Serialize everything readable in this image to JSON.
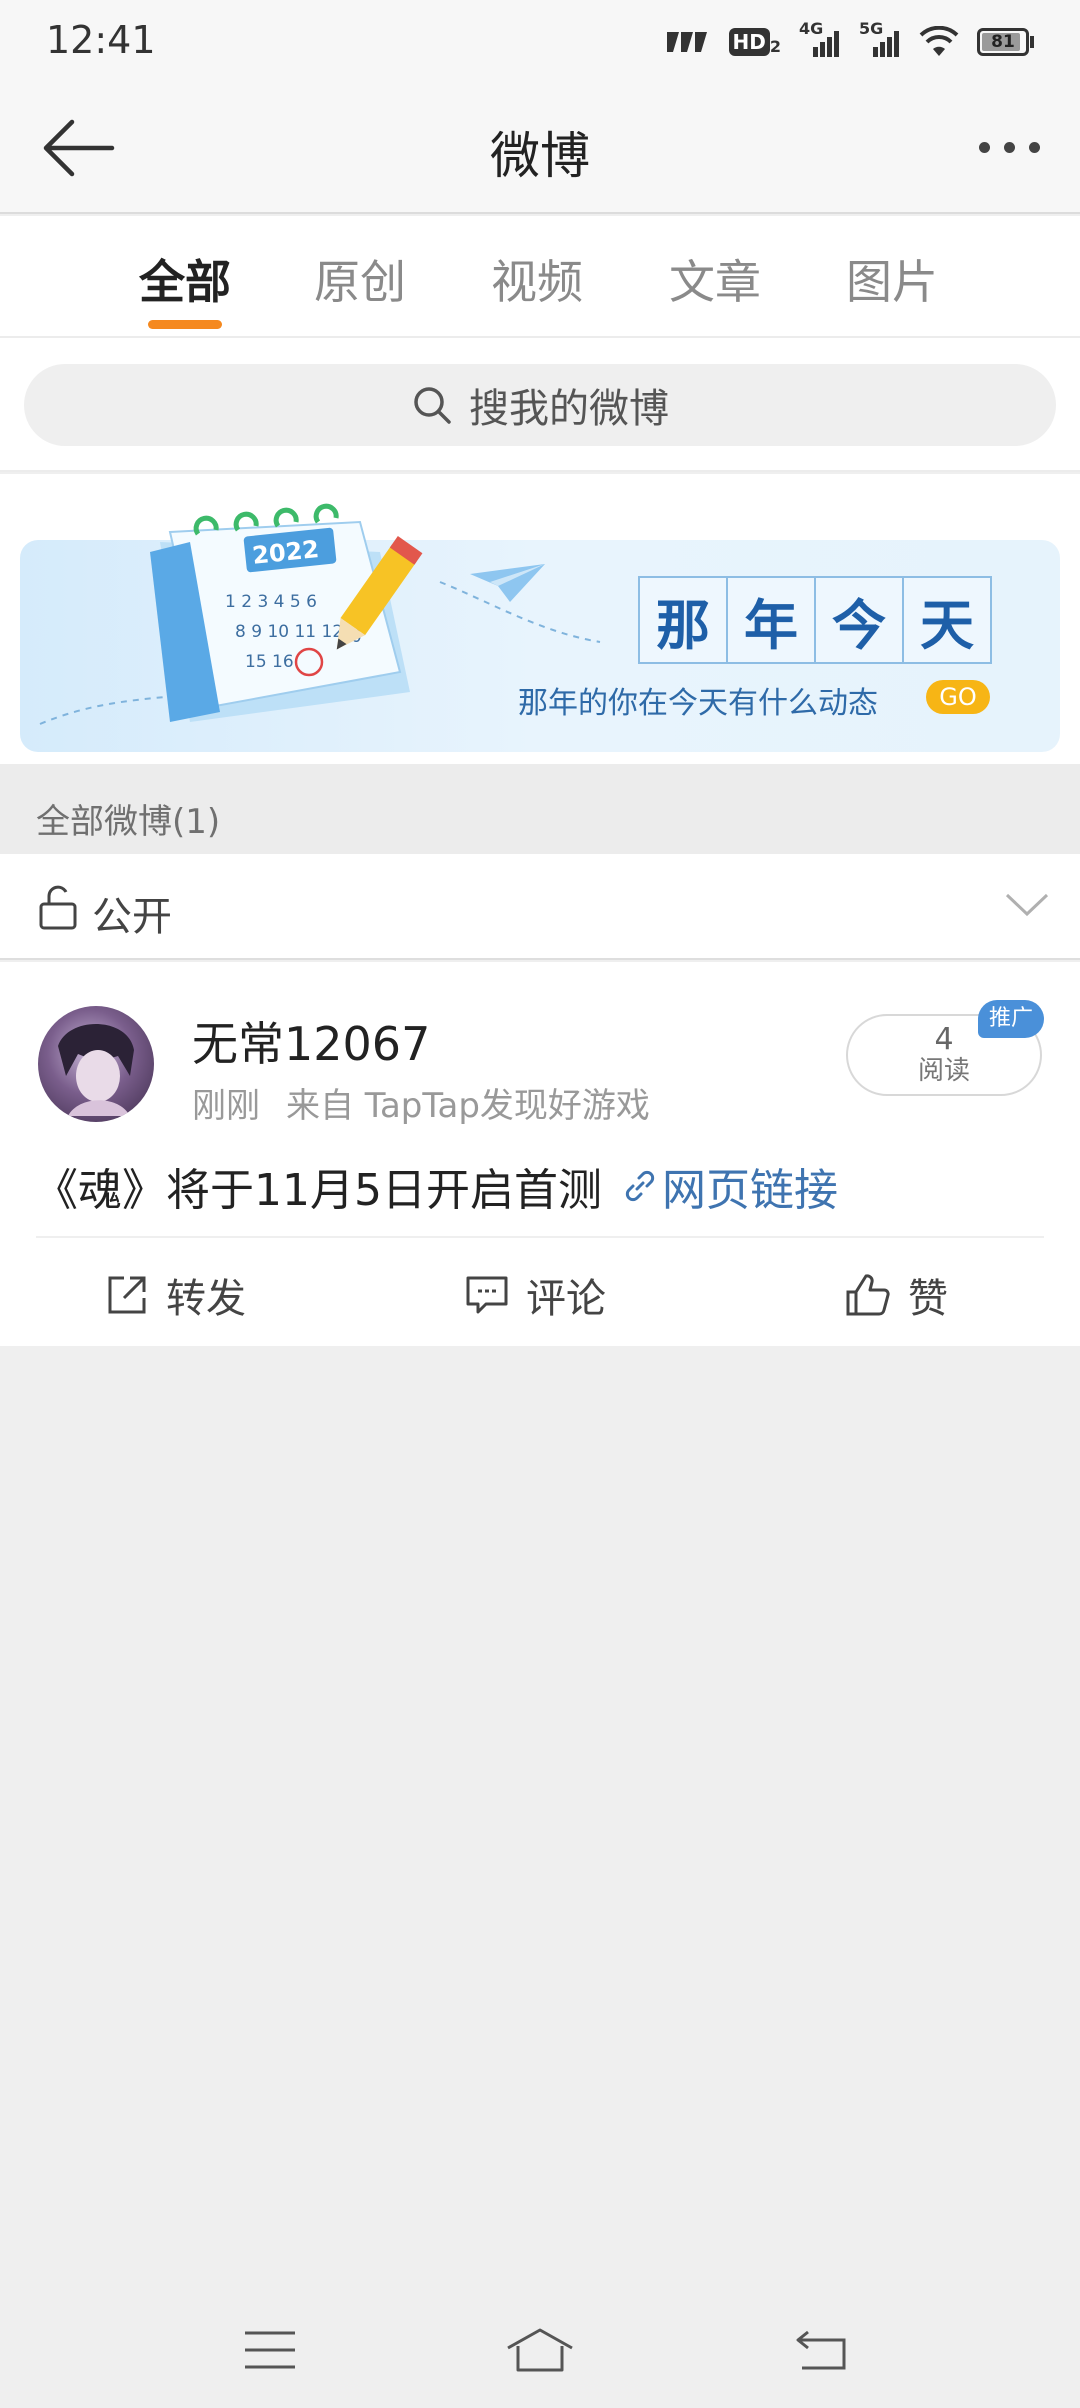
{
  "status_bar": {
    "time": "12:41",
    "network_badge": "HD",
    "network_badge_sub": "2",
    "signal_1_label": "4G",
    "signal_2_label": "5G",
    "battery": "81"
  },
  "nav": {
    "title": "微博",
    "back_icon": "arrow-left-icon",
    "more_icon": "more-dots-icon"
  },
  "tabs": [
    {
      "label": "全部",
      "active": true
    },
    {
      "label": "原创",
      "active": false
    },
    {
      "label": "视频",
      "active": false
    },
    {
      "label": "文章",
      "active": false
    },
    {
      "label": "图片",
      "active": false
    }
  ],
  "accent_color": "#f5891f",
  "search": {
    "placeholder": "搜我的微博"
  },
  "banner": {
    "title_chars": [
      "那",
      "年",
      "今",
      "天"
    ],
    "subtitle": "那年的你在今天有什么动态",
    "go_label": "GO",
    "calendar_year": "2022"
  },
  "section_header": "全部微博(1)",
  "privacy": {
    "label": "公开"
  },
  "post": {
    "username": "无常12067",
    "time": "刚刚",
    "source": "来自 TapTap发现好游戏",
    "read_count": "4",
    "read_label": "阅读",
    "promo_badge": "推广",
    "content": "《魂》将于11月5日开启首测",
    "link_text": "网页链接",
    "link_color": "#3f74b0",
    "actions": {
      "repost": "转发",
      "comment": "评论",
      "like": "赞"
    }
  }
}
